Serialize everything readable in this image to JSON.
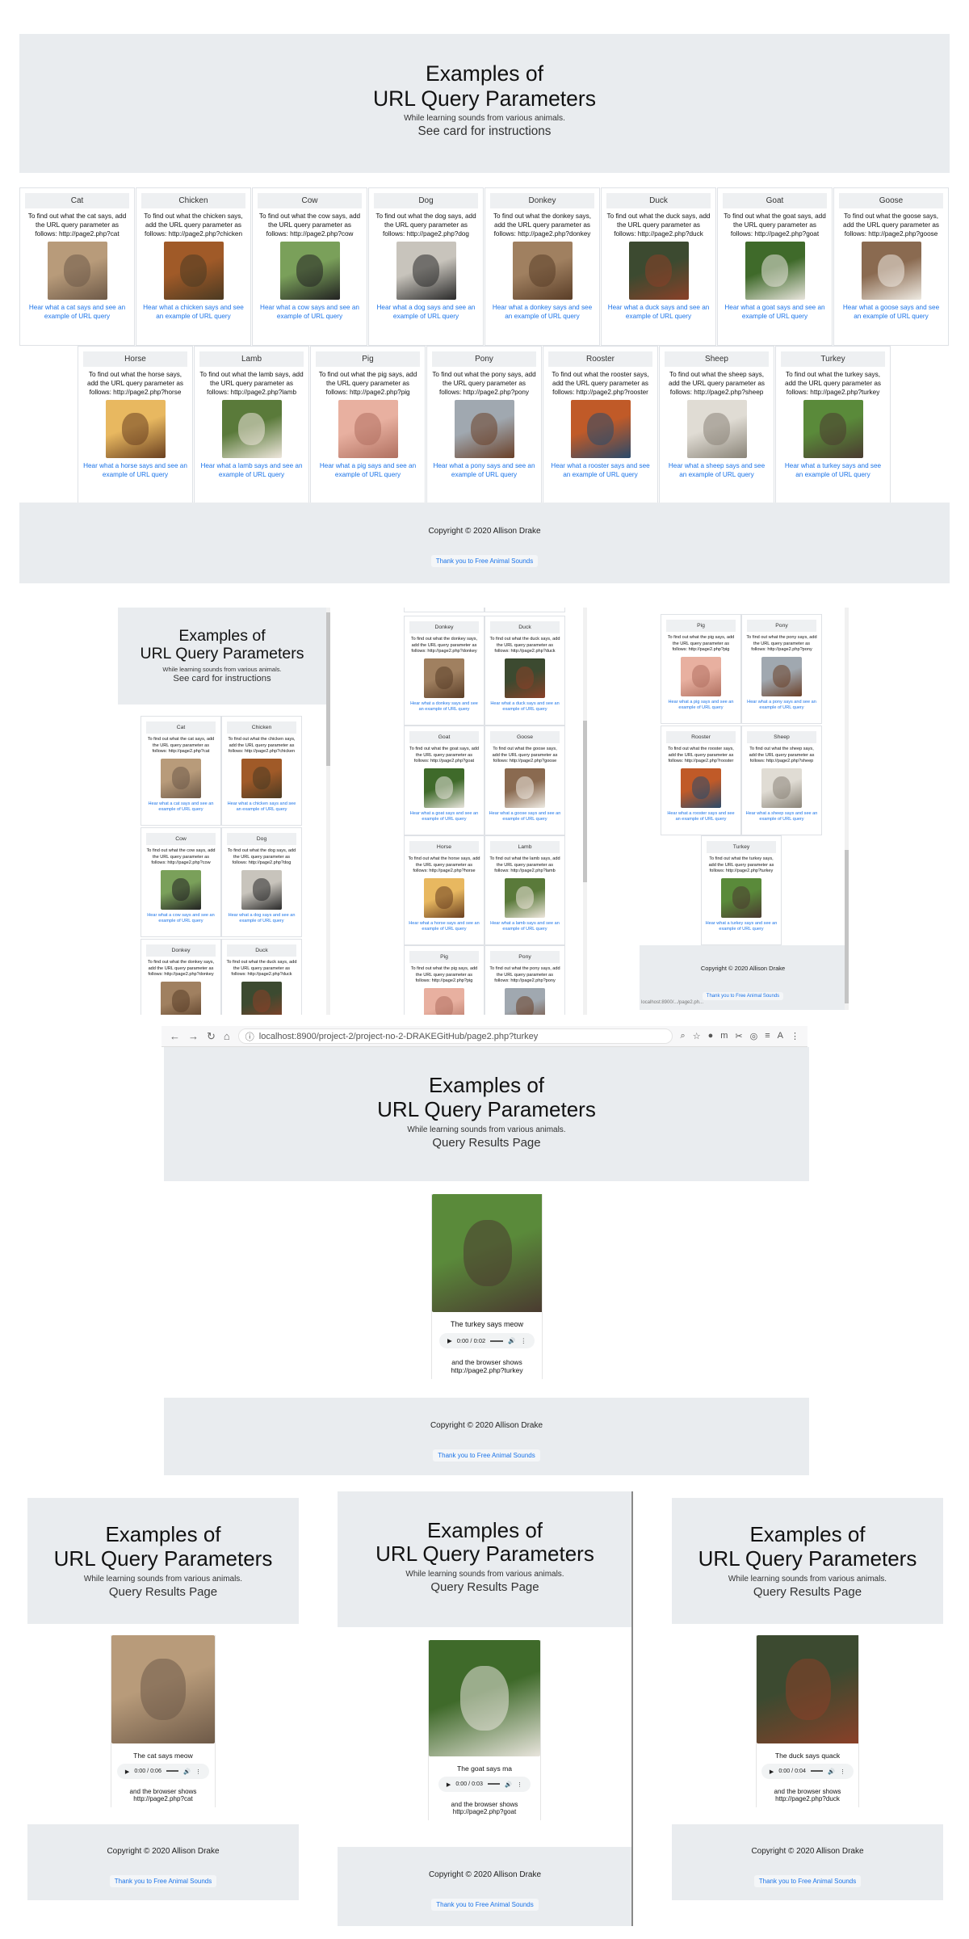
{
  "title_line1": "Examples of",
  "title_line2": "URL Query Parameters",
  "subtitle": "While learning sounds from various animals.",
  "instructions": "See card for instructions",
  "results_heading": "Query Results Page",
  "footer": {
    "copyright": "Copyright © 2020 Allison Drake",
    "thanks": "Thank you to Free Animal Sounds"
  },
  "animals": [
    {
      "name": "Cat",
      "text": "To find out what the cat says, add the URL query parameter as follows: http://page2.php?cat",
      "link": "Hear what a cat says and see an example of URL query",
      "c1": "#b89b7a",
      "c2": "#6e5a48"
    },
    {
      "name": "Chicken",
      "text": "To find out what the chicken says, add the URL query parameter as follows: http://page2.php?chicken",
      "link": "Hear what a chicken says and see an example of URL query",
      "c1": "#a05a28",
      "c2": "#4b3a22"
    },
    {
      "name": "Cow",
      "text": "To find out what the cow says, add the URL query parameter as follows: http://page2.php?cow",
      "link": "Hear what a cow says and see an example of URL query",
      "c1": "#7aa05a",
      "c2": "#222"
    },
    {
      "name": "Dog",
      "text": "To find out what the dog says, add the URL query parameter as follows: http://page2.php?dog",
      "link": "Hear what a dog says and see an example of URL query",
      "c1": "#c8c4bc",
      "c2": "#2a2a2a"
    },
    {
      "name": "Donkey",
      "text": "To find out what the donkey says, add the URL query parameter as follows: http://page2.php?donkey",
      "link": "Hear what a donkey says and see an example of URL query",
      "c1": "#a08060",
      "c2": "#5a3e28"
    },
    {
      "name": "Duck",
      "text": "To find out what the duck says, add the URL query parameter as follows: http://page2.php?duck",
      "link": "Hear what a duck says and see an example of URL query",
      "c1": "#3c4a30",
      "c2": "#8a4028"
    },
    {
      "name": "Goat",
      "text": "To find out what the goat says, add the URL query parameter as follows: http://page2.php?goat",
      "link": "Hear what a goat says and see an example of URL query",
      "c1": "#3f6a2a",
      "c2": "#e8e4dc"
    },
    {
      "name": "Goose",
      "text": "To find out what the goose says, add the URL query parameter as follows: http://page2.php?goose",
      "link": "Hear what a goose says and see an example of URL query",
      "c1": "#8a6a50",
      "c2": "#eeeae2"
    },
    {
      "name": "Horse",
      "text": "To find out what the horse says, add the URL query parameter as follows: http://page2.php?horse",
      "link": "Hear what a horse says and see an example of URL query",
      "c1": "#e8b860",
      "c2": "#6a4020"
    },
    {
      "name": "Lamb",
      "text": "To find out what the lamb says, add the URL query parameter as follows: http://page2.php?lamb",
      "link": "Hear what a lamb says and see an example of URL query",
      "c1": "#5a7a3a",
      "c2": "#eee6dc"
    },
    {
      "name": "Pig",
      "text": "To find out what the pig says, add the URL query parameter as follows: http://page2.php?pig",
      "link": "Hear what a pig says and see an example of URL query",
      "c1": "#e8b0a0",
      "c2": "#b07060"
    },
    {
      "name": "Pony",
      "text": "To find out what the pony says, add the URL query parameter as follows: http://page2.php?pony",
      "link": "Hear what a pony says and see an example of URL query",
      "c1": "#a0a8b0",
      "c2": "#6a4028"
    },
    {
      "name": "Rooster",
      "text": "To find out what the rooster says, add the URL query parameter as follows: http://page2.php?rooster",
      "link": "Hear what a rooster says and see an example of URL query",
      "c1": "#c05a28",
      "c2": "#2a4a6a"
    },
    {
      "name": "Sheep",
      "text": "To find out what the sheep says, add the URL query parameter as follows: http://page2.php?sheep",
      "link": "Hear what a sheep says and see an example of URL query",
      "c1": "#e0dcd4",
      "c2": "#8a8478"
    },
    {
      "name": "Turkey",
      "text": "To find out what the turkey says, add the URL query parameter as follows: http://page2.php?turkey",
      "link": "Hear what a turkey says and see an example of URL query",
      "c1": "#5a8a3a",
      "c2": "#4a3a30"
    }
  ],
  "browser": {
    "url": "localhost:8900/project-2/project-no-2-DRAKEGitHub/page2.php?turkey",
    "status": "localhost:8900/.../page2.ph..."
  },
  "results": {
    "turkey": {
      "says": "The turkey says meow",
      "time": "0:00 / 0:02",
      "shows": "and the browser shows",
      "query": "http://page2.php?turkey"
    },
    "cat": {
      "says": "The cat says meow",
      "time": "0:00 / 0:06",
      "shows": "and the browser shows",
      "query": "http://page2.php?cat"
    },
    "goat": {
      "says": "The goat says ma",
      "time": "0:00 / 0:03",
      "shows": "and the browser shows",
      "query": "http://page2.php?goat"
    },
    "duck": {
      "says": "The duck says quack",
      "time": "0:00 / 0:04",
      "shows": "and the browser shows",
      "query": "http://page2.php?duck"
    }
  }
}
